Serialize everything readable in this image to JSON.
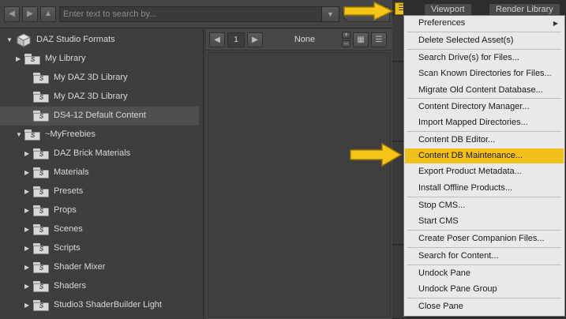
{
  "toolbar": {
    "search_placeholder": "Enter text to search by..."
  },
  "tree": {
    "items": [
      {
        "label": "DAZ Studio Formats",
        "expanded": true,
        "icon": "package-icon"
      },
      {
        "label": "My Library",
        "expanded": false,
        "icon": "folder-icon"
      },
      {
        "label": "My DAZ 3D Library",
        "icon": "folder-icon"
      },
      {
        "label": "My DAZ 3D Library",
        "icon": "folder-icon"
      },
      {
        "label": "DS4-12 Default Content",
        "icon": "folder-icon",
        "selected": true
      },
      {
        "label": "~MyFreebies",
        "expanded": true,
        "icon": "folder-icon"
      },
      {
        "label": "DAZ Brick Materials",
        "expanded": false,
        "icon": "folder-icon"
      },
      {
        "label": "Materials",
        "expanded": false,
        "icon": "folder-icon"
      },
      {
        "label": "Presets",
        "expanded": false,
        "icon": "folder-icon"
      },
      {
        "label": "Props",
        "expanded": false,
        "icon": "folder-icon"
      },
      {
        "label": "Scenes",
        "expanded": false,
        "icon": "folder-icon"
      },
      {
        "label": "Scripts",
        "expanded": false,
        "icon": "folder-icon"
      },
      {
        "label": "Shader Mixer",
        "expanded": false,
        "icon": "folder-icon"
      },
      {
        "label": "Shaders",
        "expanded": false,
        "icon": "folder-icon"
      },
      {
        "label": "Studio3 ShaderBuilder Light",
        "expanded": false,
        "icon": "folder-icon"
      }
    ]
  },
  "middle": {
    "page_number": "1",
    "filter_label": "None"
  },
  "top_tabs": [
    "Viewport",
    "Render Library"
  ],
  "menu": {
    "items": [
      {
        "label": "Preferences",
        "submenu": true
      },
      {
        "label": "Delete Selected Asset(s)"
      },
      {
        "label": "Search Drive(s) for Files..."
      },
      {
        "label": "Scan Known Directories for Files..."
      },
      {
        "label": "Migrate Old Content Database..."
      },
      {
        "label": "Content Directory Manager..."
      },
      {
        "label": "Import Mapped Directories..."
      },
      {
        "label": "Content DB Editor..."
      },
      {
        "label": "Content DB Maintenance...",
        "highlighted": true
      },
      {
        "label": "Export Product Metadata..."
      },
      {
        "label": "Install Offline Products..."
      },
      {
        "label": "Stop CMS..."
      },
      {
        "label": "Start CMS"
      },
      {
        "label": "Create Poser Companion Files..."
      },
      {
        "label": "Search for Content..."
      },
      {
        "label": "Undock Pane"
      },
      {
        "label": "Undock Pane Group"
      },
      {
        "label": "Close Pane"
      }
    ]
  },
  "colors": {
    "highlight": "#f2c01c",
    "arrow": "#f5c518",
    "panel": "#3e3e3e"
  }
}
